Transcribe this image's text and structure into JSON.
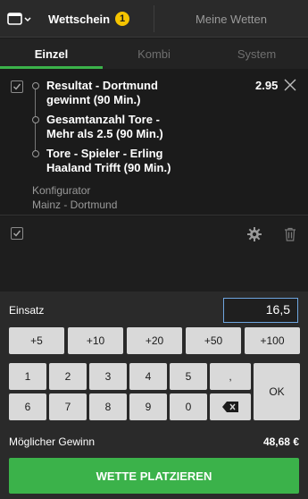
{
  "header": {
    "betslip_label": "Wettschein",
    "betslip_count": "1",
    "my_bets_label": "Meine Wetten"
  },
  "modes": [
    "Einzel",
    "Kombi",
    "System"
  ],
  "bet": {
    "selections": [
      "Resultat - Dortmund gewinnt (90 Min.)",
      "Gesamtanzahl Tore - Mehr als 2.5 (90 Min.)",
      "Tore - Spieler - Erling Haaland Trifft (90 Min.)"
    ],
    "odds": "2.95",
    "config_label": "Konfigurator",
    "match": "Mainz - Dortmund"
  },
  "stake": {
    "label": "Einsatz",
    "value": "16,5",
    "quick_buttons": [
      "+5",
      "+10",
      "+20",
      "+50",
      "+100"
    ],
    "keys_row1": [
      "1",
      "2",
      "3",
      "4",
      "5",
      ","
    ],
    "keys_row2": [
      "6",
      "7",
      "8",
      "9",
      "0"
    ],
    "ok_label": "OK",
    "payout_label": "Möglicher Gewinn",
    "payout_value": "48,68 €",
    "place_label": "WETTE PLATZIEREN"
  },
  "colors": {
    "accent_green": "#3bb24a",
    "badge_yellow": "#f5c400",
    "input_border": "#6fa6e0"
  }
}
